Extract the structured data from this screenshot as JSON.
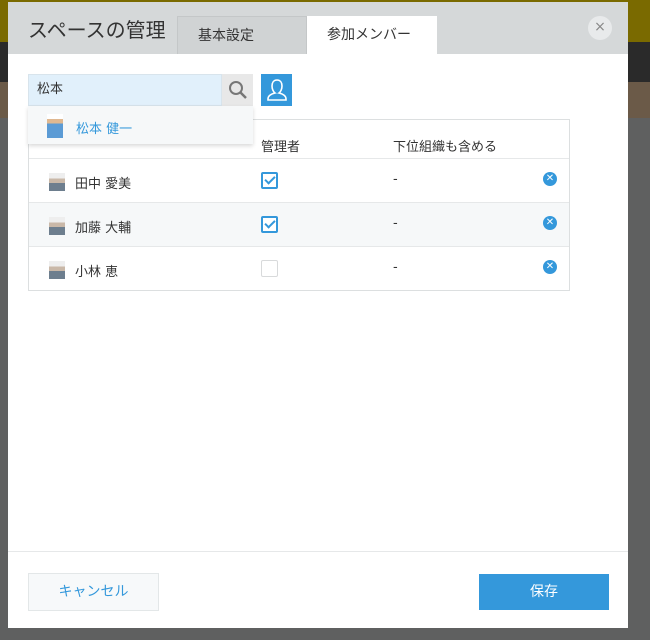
{
  "dialog": {
    "title": "スペースの管理",
    "close_icon": "×"
  },
  "tabs": [
    {
      "label": "基本設定",
      "active": false
    },
    {
      "label": "参加メンバー",
      "active": true
    }
  ],
  "search": {
    "value": "松本"
  },
  "suggestion": {
    "name": "松本 健一"
  },
  "table": {
    "headers": [
      "管理者",
      "下位組織も含める"
    ],
    "rows": [
      {
        "name": "田中 愛美",
        "admin": true,
        "include_sub": "-"
      },
      {
        "name": "加藤 大輔",
        "admin": true,
        "include_sub": "-"
      },
      {
        "name": "小林 恵",
        "admin": false,
        "include_sub": "-"
      }
    ]
  },
  "footer": {
    "cancel": "キャンセル",
    "save": "保存"
  },
  "colors": {
    "accent": "#3498db",
    "header_bg": "#d5d8d9",
    "search_bg": "#e1f0fb"
  }
}
